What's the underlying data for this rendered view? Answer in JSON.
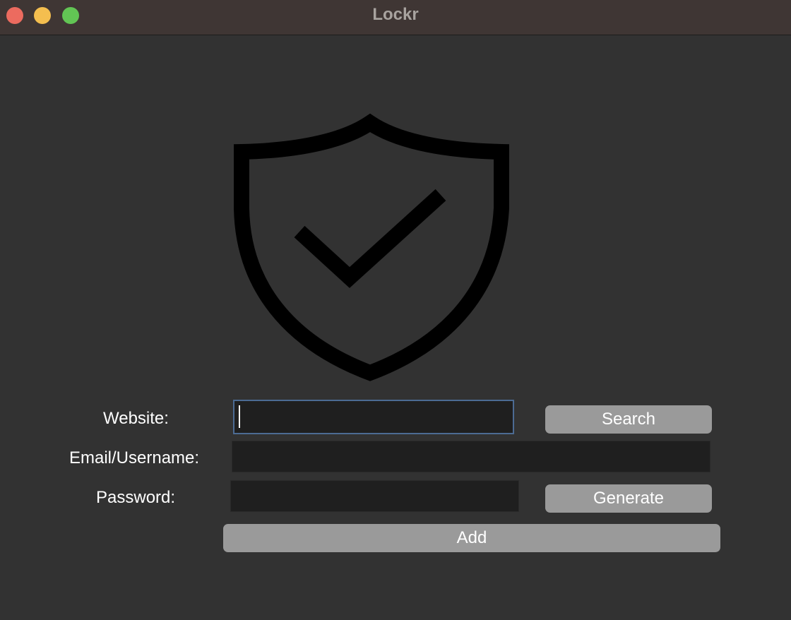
{
  "window": {
    "title": "Lockr"
  },
  "logo": {
    "icon": "shield-check-icon"
  },
  "form": {
    "website_label": "Website:",
    "website_value": "",
    "email_label": "Email/Username:",
    "email_value": "",
    "password_label": "Password:",
    "password_value": "",
    "search_button": "Search",
    "generate_button": "Generate",
    "add_button": "Add"
  },
  "colors": {
    "background": "#323232",
    "titlebar": "#3f3634",
    "field": "#1f1f1f",
    "button": "#9a9a9a",
    "focus_ring": "#4c6b93",
    "close": "#ec6b5f",
    "minimize": "#f4be4f",
    "maximize": "#62c554"
  }
}
